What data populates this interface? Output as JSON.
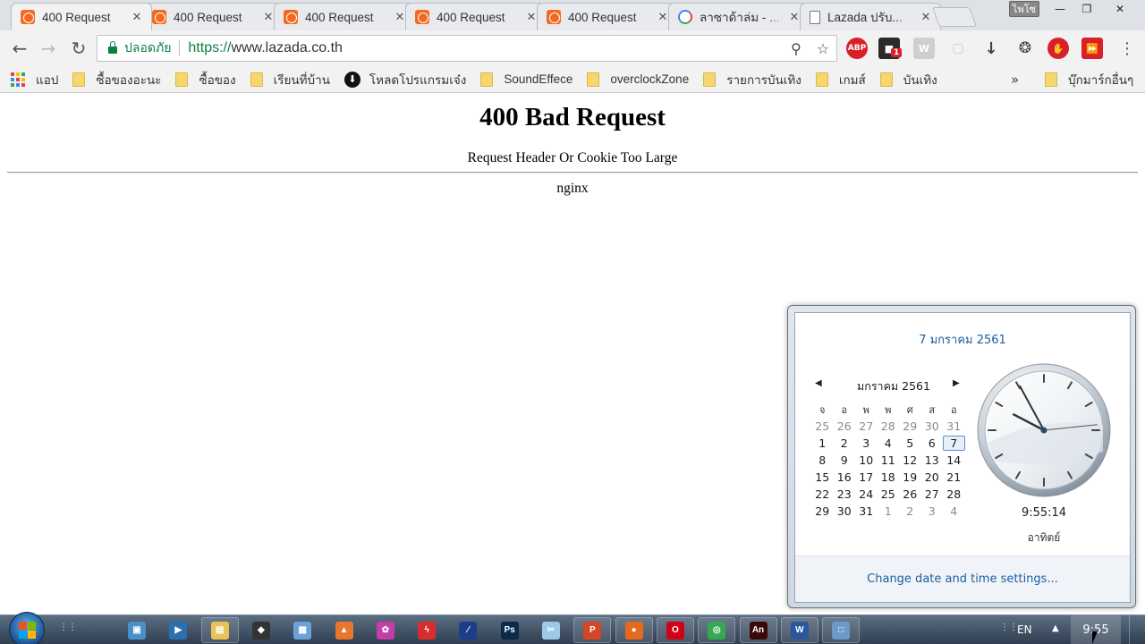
{
  "browser": {
    "tabs": [
      {
        "title": "400 Request",
        "favicon": "lazada-icon",
        "active": true
      },
      {
        "title": "400 Request",
        "favicon": "lazada-icon"
      },
      {
        "title": "400 Request",
        "favicon": "lazada-icon"
      },
      {
        "title": "400 Request",
        "favicon": "lazada-icon"
      },
      {
        "title": "400 Request",
        "favicon": "lazada-icon"
      },
      {
        "title": "ลาซาด้าล่ม - ...",
        "favicon": "google-icon"
      },
      {
        "title": "Lazada ปรับ...",
        "favicon": "document-icon"
      }
    ],
    "user_label": "ไพโซ",
    "address": {
      "secure_label": "ปลอดภัย",
      "scheme_host": "https://",
      "host": "www.lazada.co.th"
    },
    "extensions": [
      "abp-icon",
      "notification-icon",
      "w-icon",
      "camera-icon",
      "download-icon",
      "film-icon",
      "stop-icon",
      "video-icon"
    ],
    "extension_badge": "1",
    "abp_label": "ABP",
    "w_label": "W",
    "bookmarks": [
      {
        "label": "แอป",
        "icon": "apps-icon"
      },
      {
        "label": "ซื้อของอะนะ",
        "icon": "folder-icon"
      },
      {
        "label": "ซื้อของ",
        "icon": "folder-icon"
      },
      {
        "label": "เรียนที่บ้าน",
        "icon": "folder-icon"
      },
      {
        "label": "โหลดโปรแกรมเจ๋ง",
        "icon": "download-circle-icon"
      },
      {
        "label": "SoundEffece",
        "icon": "folder-icon"
      },
      {
        "label": "overclockZone",
        "icon": "folder-icon"
      },
      {
        "label": "รายการบันเทิง",
        "icon": "folder-icon"
      },
      {
        "label": "เกมส์",
        "icon": "folder-icon"
      },
      {
        "label": "บันเทิง",
        "icon": "folder-icon"
      }
    ],
    "bookmarks_more": "»",
    "other_bookmarks": "บุ๊กมาร์กอื่นๆ"
  },
  "page": {
    "title": "400 Bad Request",
    "message": "Request Header Or Cookie Too Large",
    "server": "nginx"
  },
  "calendar_popup": {
    "long_date": "7 มกราคม 2561",
    "month_label": "มกราคม 2561",
    "weekdays": [
      "จ",
      "อ",
      "พ",
      "พ",
      "ศ",
      "ส",
      "อ"
    ],
    "weeks": [
      [
        "25",
        "26",
        "27",
        "28",
        "29",
        "30",
        "31"
      ],
      [
        "1",
        "2",
        "3",
        "4",
        "5",
        "6",
        "7"
      ],
      [
        "8",
        "9",
        "10",
        "11",
        "12",
        "13",
        "14"
      ],
      [
        "15",
        "16",
        "17",
        "18",
        "19",
        "20",
        "21"
      ],
      [
        "22",
        "23",
        "24",
        "25",
        "26",
        "27",
        "28"
      ],
      [
        "29",
        "30",
        "31",
        "1",
        "2",
        "3",
        "4"
      ]
    ],
    "selected_day": "7",
    "time": "9:55:14",
    "day_name": "อาทิตย์",
    "settings_link": "Change date and time settings..."
  },
  "taskbar": {
    "apps": [
      "monitor-icon",
      "media-player-icon",
      "explorer-icon",
      "stack-icon",
      "photo-icon",
      "flame-icon",
      "paint-icon",
      "flash-icon",
      "compass-icon",
      "photoshop-icon",
      "snip-icon",
      "powerpoint-icon",
      "firefox-icon",
      "opera-icon",
      "chrome-icon",
      "animate-icon",
      "word-icon",
      "window-icon"
    ],
    "language": "EN",
    "clock": "9:55"
  },
  "colors": {
    "secure_green": "#0b8043",
    "link_blue": "#1c5e9e",
    "lazada_orange": "#f26a21"
  }
}
